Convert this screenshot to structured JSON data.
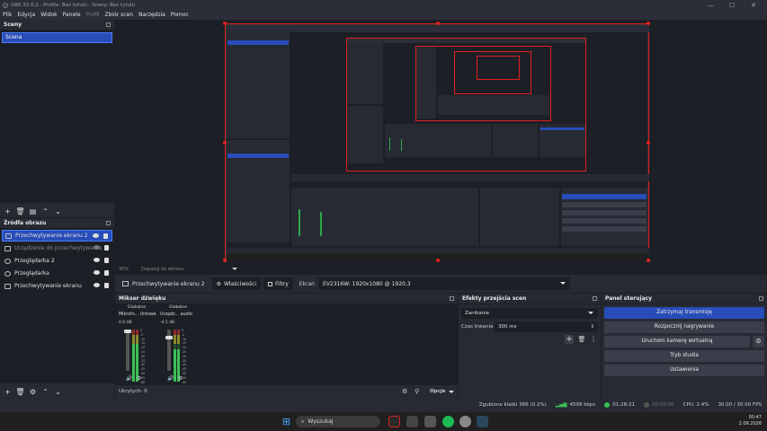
{
  "window": {
    "title": "OBS 32.0.2 - Profile: Bez tytułu - Sceny: Bez tytułu",
    "minimize": "—",
    "maximize": "☐",
    "close": "✕"
  },
  "menu": [
    "Plik",
    "Edycja",
    "Widok",
    "Panele",
    "Profil",
    "Zbiór scen",
    "Narzędzia",
    "Pomoc"
  ],
  "scenes": {
    "title": "Sceny",
    "items": [
      "Scena"
    ]
  },
  "sources": {
    "title": "Źródła obrazu",
    "items": [
      {
        "label": "Przechwytywanie ekranu 2",
        "selected": true
      },
      {
        "label": "Urządzenie do przechwytywania",
        "dim": true
      },
      {
        "label": "Przeglądarka 2"
      },
      {
        "label": "Przeglądarka"
      },
      {
        "label": "Przechwytywanie ekranu"
      }
    ]
  },
  "preview_status": {
    "zoom": "35%",
    "fit": "Dopasuj do ekranu"
  },
  "context_bar": {
    "source_name": "Przechwytywanie ekranu 2",
    "properties": "Właściwości",
    "filters": "Filtry",
    "screen_label": "Ekran",
    "screen_value": "EV2316W: 1920x1080 @ 1920,3"
  },
  "mixer": {
    "title": "Mikser dźwięku",
    "channels": [
      {
        "group": "Globalne",
        "name": "Mikrofo... (Intowe",
        "db": "0.0 dB",
        "level": 0.72
      },
      {
        "group": "Globalne",
        "name": "Urządz... audio",
        "db": "-4.5 dB",
        "level": 0.62
      }
    ],
    "scale": [
      "0",
      "-5",
      "-10",
      "-15",
      "-20",
      "-25",
      "-30",
      "-35",
      "-40",
      "-45",
      "-50",
      "-55",
      "-60"
    ],
    "hidden": "Ukrytych: 0",
    "options": "Opcje"
  },
  "transitions": {
    "title": "Efekty przejścia scen",
    "effect": "Zanikanie",
    "duration_label": "Czas trwania",
    "duration_value": "300 ms"
  },
  "controls": {
    "title": "Panel sterujący",
    "buttons": [
      "Zatrzymaj transmisję",
      "Rozpocznij nagrywanie",
      "Uruchom kamerę wirtualną",
      "Tryb studia",
      "Ustawienia"
    ]
  },
  "statusbar": {
    "dropped": "Zgubione klatki 366 (0.2%)",
    "bitrate": "4599 kbps",
    "stream_time": "01:28:21",
    "rec_time": "00:00:00",
    "cpu": "CPU: 2.4%",
    "fps": "30.00 / 30.00 FPS"
  },
  "taskbar": {
    "search": "Wyszukaj",
    "time": "00:47",
    "date": "2.09.2026"
  },
  "colors": {
    "accent": "#284cb8",
    "bg": "#1d1f26",
    "panel": "#272a33",
    "red_outline": "#e02020",
    "meter_green": "#39c054"
  }
}
